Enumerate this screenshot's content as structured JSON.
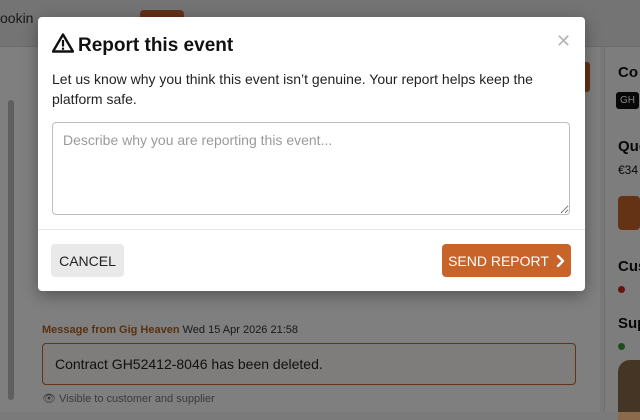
{
  "background": {
    "tab_label": "ookin",
    "message_header_sender": "Message from Gig Heaven",
    "message_header_date": "Wed 15 Apr 2026 21:58",
    "message_text": "Contract GH52412-8046 has been deleted.",
    "visibility": "Visible to customer and supplier",
    "right_title": "Co",
    "right_badge": "GH",
    "right_quote": "Quo",
    "right_price": "€34",
    "right_customer": "Cus",
    "right_supplier": "Sup",
    "status_red_color": "#cc2a1a",
    "status_green_color": "#3a9a3a"
  },
  "modal": {
    "icon": "warning-triangle-icon",
    "title": "Report this event",
    "close_icon": "close-icon",
    "description": "Let us know why you think this event isn’t genuine. Your report helps keep the platform safe.",
    "textarea_placeholder": "Describe why you are reporting this event...",
    "textarea_value": "",
    "cancel_label": "CANCEL",
    "send_label": "SEND REPORT",
    "send_icon": "chevron-right-icon",
    "accent_color": "#c8642a"
  }
}
